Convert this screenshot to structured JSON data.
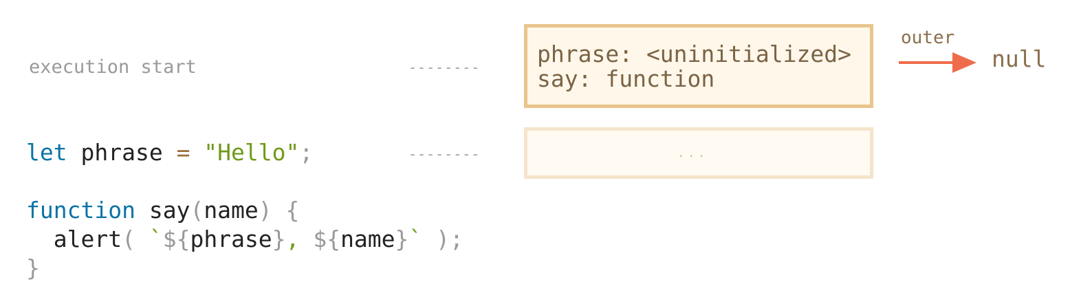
{
  "rows": {
    "execution_start": {
      "label": "execution start",
      "connector": "--------"
    },
    "let_phrase": {
      "connector": "--------",
      "ellipsis": "..."
    }
  },
  "code": {
    "let_line": {
      "keyword": "let",
      "identifier": " phrase ",
      "operator": "=",
      "string": " \"Hello\"",
      "end": ";"
    },
    "function_line": {
      "keyword": "function",
      "name": " say",
      "paren_open": "(",
      "param": "name",
      "paren_close": ")",
      "brace": " {"
    },
    "alert_line": {
      "indent": "  ",
      "call": "alert",
      "paren_open": "( ",
      "tick_open": "`",
      "interp_open_1": "${",
      "var_1": "phrase",
      "interp_close_1": "}",
      "sep": ", ",
      "interp_open_2": "${",
      "var_2": "name",
      "interp_close_2": "}",
      "tick_close": "`",
      "paren_close": " );"
    },
    "close_brace": "}"
  },
  "environment": {
    "line_1": "phrase: <uninitialized>",
    "line_2": "say: function",
    "outer_label": "outer",
    "outer_target": "null"
  },
  "colors": {
    "keyword": "#0b73a6",
    "string": "#6e9a18",
    "box_border": "#e9c58b",
    "box_fill": "#fff7e9",
    "arrow": "#ef6c4b"
  },
  "icons": {
    "outer_arrow": "right-arrow-icon"
  }
}
